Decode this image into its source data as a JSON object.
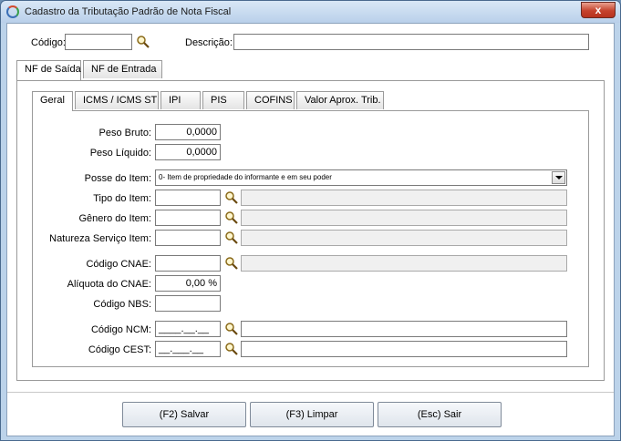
{
  "window": {
    "title": "Cadastro da Tributação Padrão de Nota Fiscal",
    "close": "x"
  },
  "header": {
    "codigo_label": "Código:",
    "codigo_value": "",
    "descricao_label": "Descrição:",
    "descricao_value": ""
  },
  "outer_tabs": [
    "NF de Saída",
    "NF de Entrada"
  ],
  "inner_tabs": [
    "Geral",
    "ICMS / ICMS ST",
    "IPI",
    "PIS",
    "COFINS",
    "Valor Aprox. Trib."
  ],
  "geral": {
    "peso_bruto_label": "Peso Bruto:",
    "peso_bruto_value": "0,0000",
    "peso_liquido_label": "Peso Líquido:",
    "peso_liquido_value": "0,0000",
    "posse_label": "Posse do Item:",
    "posse_value": "0- Item de propriedade do informante e em seu poder",
    "tipo_label": "Tipo do Item:",
    "tipo_value": "",
    "tipo_desc": "",
    "genero_label": "Gênero do Item:",
    "genero_value": "",
    "genero_desc": "",
    "natureza_label": "Natureza Serviço Item:",
    "natureza_value": "",
    "natureza_desc": "",
    "cnae_label": "Código CNAE:",
    "cnae_value": "",
    "cnae_desc": "",
    "aliquota_label": "Alíquota do CNAE:",
    "aliquota_value": "0,00 %",
    "nbs_label": "Código NBS:",
    "nbs_value": "",
    "ncm_label": "Código NCM:",
    "ncm_value": "____.__.__",
    "ncm_desc": "",
    "cest_label": "Código CEST:",
    "cest_value": "__.___.__",
    "cest_desc": ""
  },
  "buttons": {
    "save": "(F2) Salvar",
    "clear": "(F3) Limpar",
    "exit": "(Esc) Sair"
  },
  "icons": {
    "lookup": "magnifier-icon",
    "app": "app-icon",
    "dropdown": "chevron-down-icon"
  }
}
